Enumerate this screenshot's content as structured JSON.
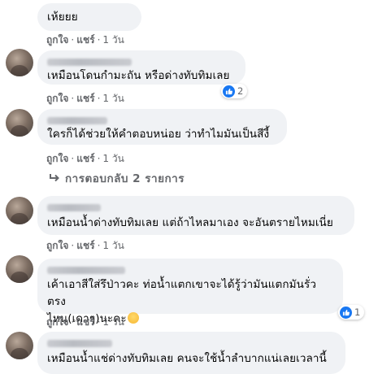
{
  "comments": [
    {
      "text": "เห้ยยย",
      "like": "ถูกใจ",
      "share": "แชร์",
      "time": "1 วัน"
    },
    {
      "text": "เหมือนโดนกำมะถัน หรือด่างทับทิมเลย",
      "like": "ถูกใจ",
      "share": "แชร์",
      "time": "1 วัน",
      "reactions": "2"
    },
    {
      "text": "ใครก็ได้ช่วยให้คำตอบหน่อย ว่าทำไมมันเป็นสีงี้",
      "like": "ถูกใจ",
      "share": "แชร์",
      "time": "1 วัน"
    },
    {
      "text": "เหมือนน้ำด่างทับทิมเลย แต่ถ้าไหลมาเอง จะอันตรายไหมเนี่ย",
      "like": "ถูกใจ",
      "share": "แชร์",
      "time": "1 วัน"
    },
    {
      "text_line1": "เค้าเอาสีใส่รึป่าวคะ ท่อน้ำแตกเขาจะได้รู้ว่ามันแตกมันรั่วตรง",
      "text_line2": "ไหน(เดาๆ)นะคะ",
      "like": "ถูกใจ",
      "share": "แชร์",
      "time": "1 วัน",
      "reactions": "1"
    },
    {
      "text": "เหมือนน้ำแช่ด่างทับทิมเลย คนจะใช้น้ำลำบากแน่เลยเวลานี้"
    }
  ],
  "replies_link": "การตอบกลับ 2 รายการ",
  "separator": "·",
  "colors": {
    "bubble": "#f0f2f5",
    "meta": "#65676b",
    "like_blue": "#1877f2"
  }
}
